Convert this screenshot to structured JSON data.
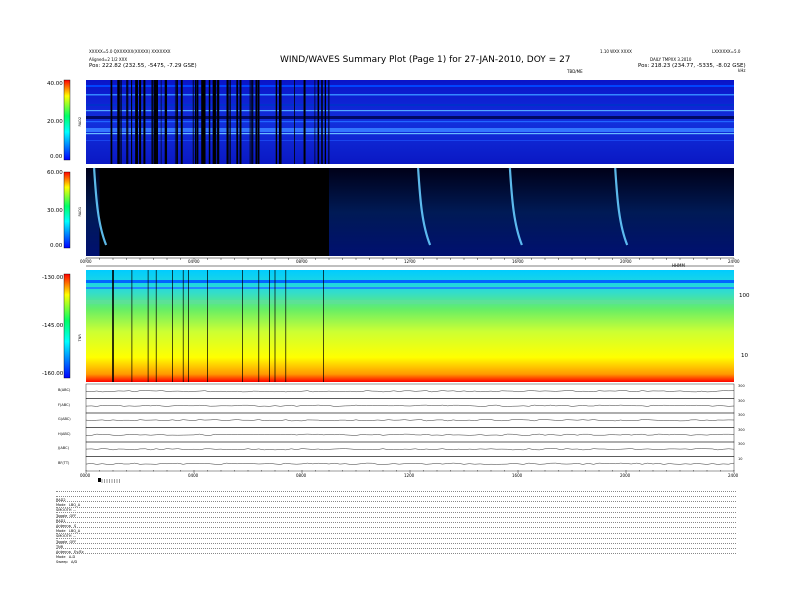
{
  "header": {
    "title": "WIND/WAVES Summary Plot (Page 1) for 27-JAN-2010, DOY = 27",
    "left_line1": "XXXXX=5.0 QXXXXXX(XXXXX) XXXXXXX",
    "left_line2": "Aligned=2 1/2 XXX",
    "left_line3": "Pos: 222.82 (232.55, -5475, -7.29 GSE)",
    "right_line1": "1.10 WXX XXXX",
    "right_line2": "LXXXXXX=5.0",
    "right_line3": "DAILY TMPXX 3.2010",
    "right_line4": "Pos: 218.23 (234.77, -5335, -8.02 GSE)",
    "right_corner": "kHz",
    "tbd_label": "TBD/ME"
  },
  "colors": {
    "background": "#0000cc",
    "burst": "#66ccff",
    "dark": "#000000"
  },
  "panels": {
    "rad2": {
      "name": "RAD2",
      "ticks": [
        "40.00",
        "20.00",
        "0.00"
      ]
    },
    "rad1": {
      "name": "RAD1",
      "ticks": [
        "60.00",
        "30.00",
        "0.00"
      ]
    },
    "tnr": {
      "name": "TNR",
      "ticks": [
        "-130.00",
        "-145.00",
        "-160.00"
      ],
      "right_ticks": [
        "100",
        "10"
      ]
    },
    "time_ticks_top": [
      "00:00",
      "04:00",
      "08:00",
      "12:00",
      "16:00",
      "20:00",
      "24:00"
    ],
    "time_ticks_bottom": [
      "0000",
      "0400",
      "0800",
      "1200",
      "1600",
      "2000",
      "2400"
    ],
    "hhmm_label": "HHMM"
  },
  "line_panels": [
    {
      "label": "B(ABC)",
      "right": "300"
    },
    {
      "label": "F(ABC)",
      "right": "300"
    },
    {
      "label": "G(ABC)",
      "right": "300"
    },
    {
      "label": "H(ABC)",
      "right": "300"
    },
    {
      "label": "J(ABC)",
      "right": "300"
    },
    {
      "label": "BF(TT)",
      "right": "10"
    }
  ],
  "settings": [
    "RAD2",
    "Mode   LBQ_A",
    "SMOOTH ...   ",
    "Toggle  OFF",
    "RAD1",
    "Antenna   S",
    "Mode   LBQ_A",
    "SMOOTH ...",
    "Toggle  OFF",
    "TNR",
    "Antenna   Ey/Ez",
    "Mode   A-D",
    "Sweep   A/D"
  ],
  "chart_data": {
    "type": "heatmap",
    "title": "WIND/WAVES Summary Plot (Page 1) for 27-JAN-2010, DOY = 27",
    "xlabel": "HHMM",
    "x_range_hours": [
      0,
      24
    ],
    "panels": [
      "RAD2",
      "RAD1",
      "TNR"
    ],
    "rad1_burst_hours": [
      0.3,
      12.3,
      15.7,
      19.6
    ],
    "data_gap_hours_rad1": [
      0.5,
      9.0
    ]
  }
}
